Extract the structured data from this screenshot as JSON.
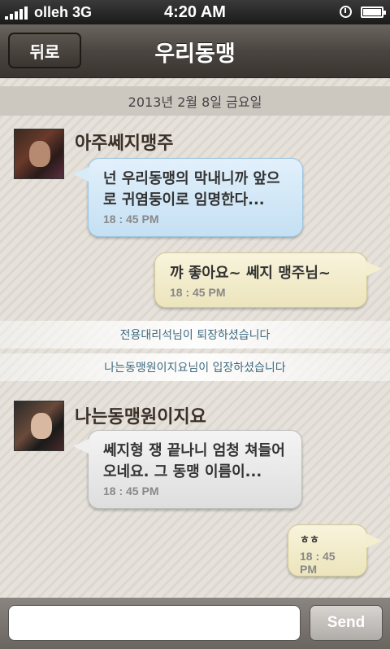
{
  "status_bar": {
    "carrier": "olleh",
    "network": "3G",
    "time": "4:20 AM",
    "icons": [
      "signal-icon",
      "alarm-icon",
      "battery-icon"
    ]
  },
  "nav": {
    "back_label": "뒤로",
    "title": "우리동맹"
  },
  "chat": {
    "date": "2013년 2월 8일 금요일",
    "messages": [
      {
        "sender": "아주쎄지맹주",
        "text": "넌 우리동맹의 막내니까 앞으\n로 귀염둥이로 임명한다...",
        "time": "18 : 45 PM"
      },
      {
        "text": "꺄 좋아요~ 쎄지 맹주님~",
        "time": "18 : 45 PM"
      },
      {
        "sender": "나는동맹원이지요",
        "text": "쎄지형 쟁 끝나니 엄청 쳐들어\n오네요. 그 동맹 이름이...",
        "time": "18 : 45 PM"
      },
      {
        "text": "ㅎㅎ",
        "time": "18 : 45 PM"
      }
    ],
    "system_messages": [
      "전용대리석님이 퇴장하셨습니다",
      "나는동맹원이지요님이 입장하셨습니다"
    ]
  },
  "input": {
    "value": "",
    "send_label": "Send"
  },
  "colors": {
    "blue_bubble": "#c4e0f3",
    "yellow_bubble": "#ece4bc",
    "gray_bubble": "#dedede",
    "system_text": "#3d6b80"
  }
}
